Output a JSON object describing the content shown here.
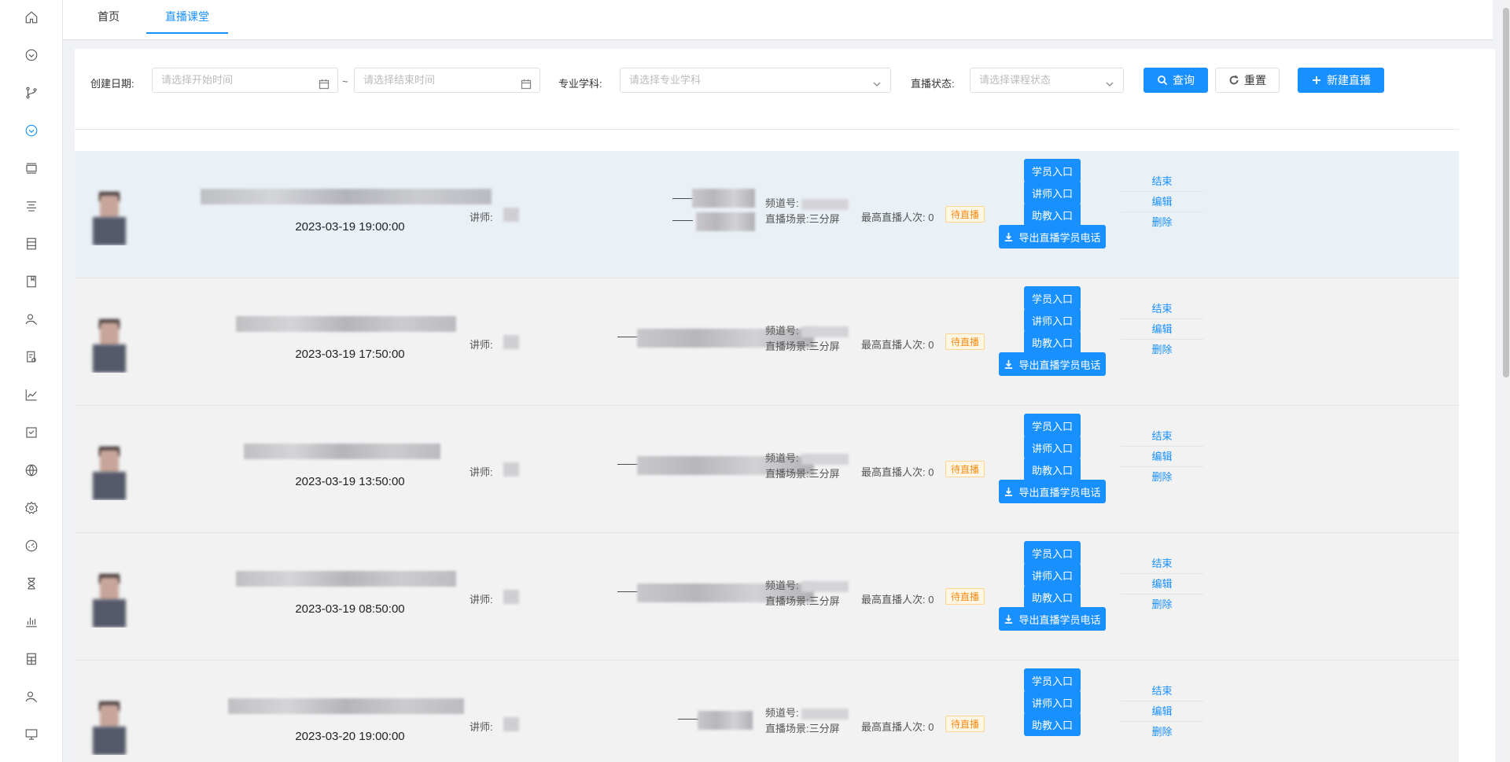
{
  "tabs": [
    {
      "label": "首页"
    },
    {
      "label": "直播课堂"
    }
  ],
  "filters": {
    "date_label": "创建日期:",
    "start_placeholder": "请选择开始时间",
    "tilde": "~",
    "end_placeholder": "请选择结束时间",
    "subject_label": "专业学科:",
    "subject_placeholder": "请选择专业学科",
    "status_label": "直播状态:",
    "status_placeholder": "请选择课程状态",
    "query_label": "查询",
    "reset_label": "重置",
    "new_label": "新建直播"
  },
  "labels": {
    "teacher": "讲师:",
    "channel": "频道号:",
    "scene": "直播场景:",
    "max_viewers": "最高直播人次:",
    "student_entry": "学员入口",
    "teacher_entry": "讲师入口",
    "assistant_entry": "助教入口",
    "export_phones": "导出直播学员电话",
    "end": "结束",
    "edit": "编辑",
    "delete": "删除"
  },
  "rows": [
    {
      "datetime": "2023-03-19 19:00:00",
      "scene_value": "三分屏",
      "max_count": "0",
      "status": "待直播"
    },
    {
      "datetime": "2023-03-19 17:50:00",
      "scene_value": "三分屏",
      "max_count": "0",
      "status": "待直播"
    },
    {
      "datetime": "2023-03-19 13:50:00",
      "scene_value": "三分屏",
      "max_count": "0",
      "status": "待直播"
    },
    {
      "datetime": "2023-03-19 08:50:00",
      "scene_value": "三分屏",
      "max_count": "0",
      "status": "待直播"
    },
    {
      "datetime": "2023-03-20 19:00:00",
      "scene_value": "三分屏",
      "max_count": "0",
      "status": "待直播"
    }
  ],
  "colors": {
    "primary": "#1890ff",
    "warning": "#fa8c16"
  }
}
